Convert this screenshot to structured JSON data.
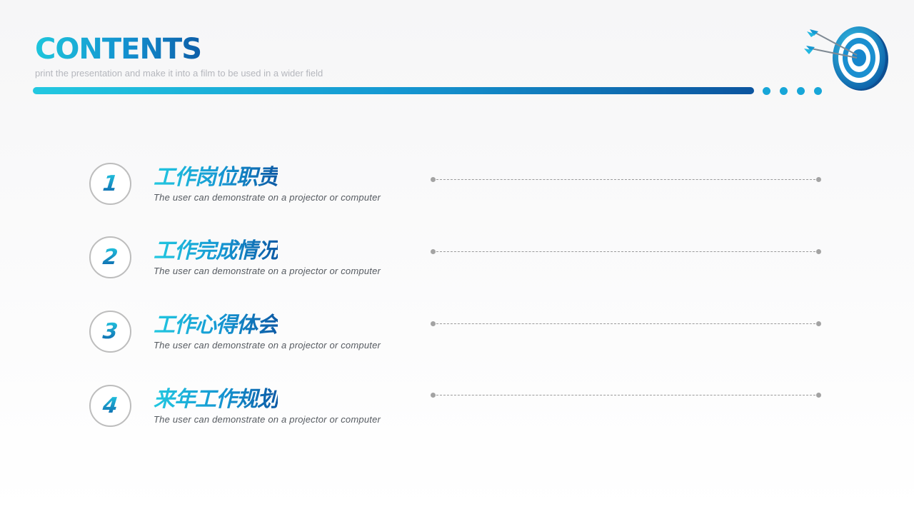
{
  "header": {
    "title": "CONTENTS",
    "subtitle": "print the presentation and make it into a film to be used in a wider field"
  },
  "decor": {
    "target_icon": "target-with-arrows-icon",
    "accent_colors": [
      "#22c8e0",
      "#1596d2",
      "#0c5aa5"
    ]
  },
  "items": [
    {
      "number": "1",
      "title": "工作岗位职责",
      "desc": "The user can demonstrate on a projector or computer"
    },
    {
      "number": "2",
      "title": "工作完成情况",
      "desc": "The user can demonstrate on a projector or computer"
    },
    {
      "number": "3",
      "title": "工作心得体会",
      "desc": "The user can demonstrate on a projector or computer"
    },
    {
      "number": "4",
      "title": "来年工作规划",
      "desc": "The user can demonstrate on a projector or computer"
    }
  ]
}
